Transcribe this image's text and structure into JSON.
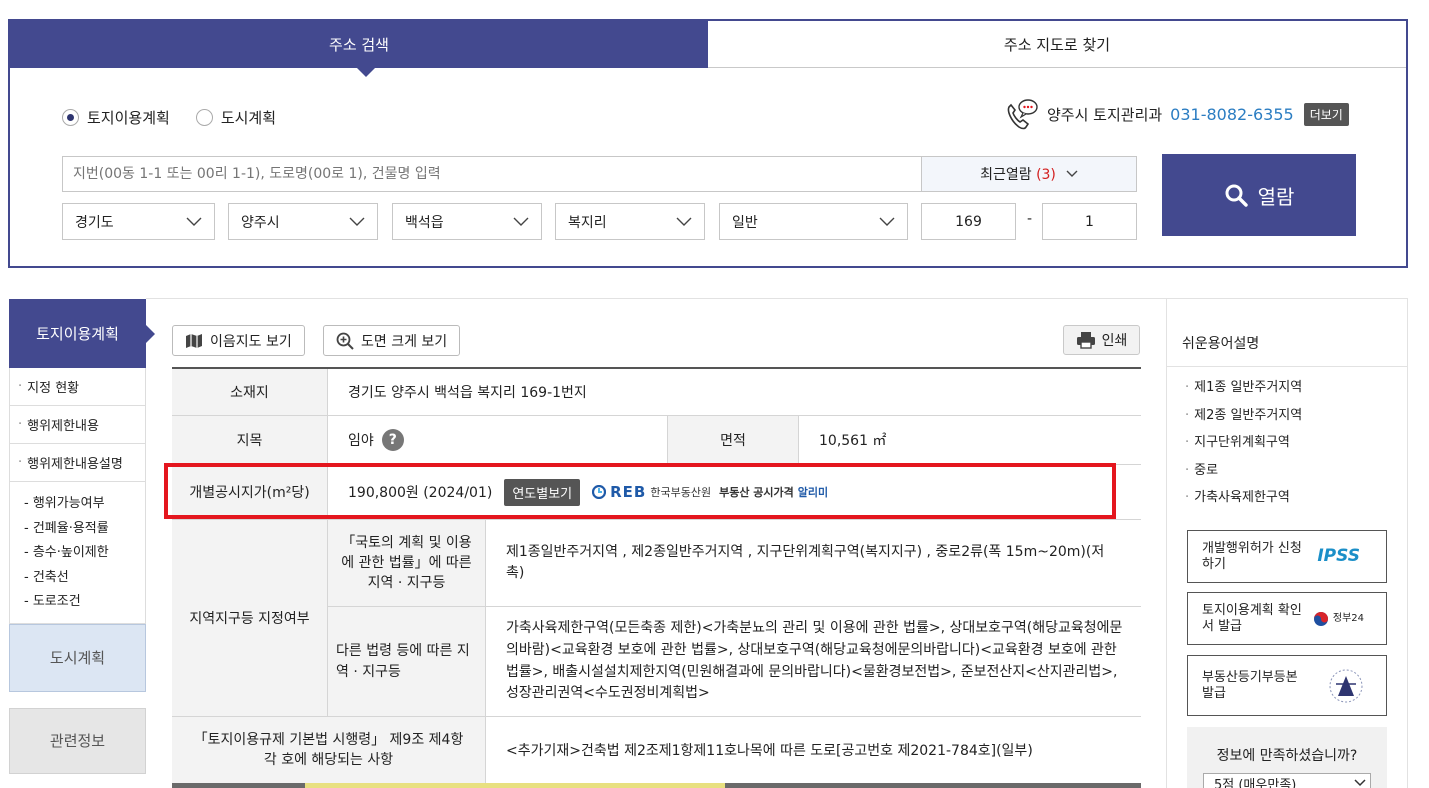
{
  "tabs": {
    "search": "주소 검색",
    "map": "주소 지도로 찾기"
  },
  "radios": [
    {
      "label": "토지이용계획",
      "checked": true
    },
    {
      "label": "도시계획",
      "checked": false
    }
  ],
  "contact": {
    "office": "양주시 토지관리과",
    "phone": "031-8082-6355",
    "more": "더보기"
  },
  "search": {
    "placeholder": "지번(00동 1-1 또는 00리 1-1), 도로명(00로 1), 건물명 입력",
    "recent_label": "최근열람",
    "recent_count": "(3)",
    "button": "열람"
  },
  "selects": {
    "province": "경기도",
    "city": "양주시",
    "town": "백석읍",
    "village": "복지리",
    "type": "일반",
    "main_no": "169",
    "dash": "-",
    "sub_no": "1"
  },
  "left_nav": {
    "head": "토지이용계획",
    "items": [
      "지정 현황",
      "행위제한내용",
      "행위제한내용설명"
    ],
    "sub_items": [
      "- 행위가능여부",
      "- 건폐율·용적률",
      "- 층수·높이제한",
      "- 건축선",
      "- 도로조건"
    ],
    "urban": "도시계획",
    "related": "관련정보"
  },
  "toolbar": {
    "map_view": "이음지도 보기",
    "zoom_view": "도면 크게 보기",
    "print": "인쇄"
  },
  "info": {
    "location_label": "소재지",
    "location": "경기도 양주시 백석읍 복지리 169-1번지",
    "jimok_label": "지목",
    "jimok": "임야",
    "area_label": "면적",
    "area": "10,561 ㎡",
    "price_label": "개별공시지가(m²당)",
    "price": "190,800원 (2024/01)",
    "year_btn": "연도별보기",
    "reb_logo": "REB",
    "reb_name": "한국부동산원",
    "reb_service": "부동산 공시가격",
    "reb_app": "알리미",
    "zone_label": "지역지구등 지정여부",
    "zone_sub1_label": "「국토의 계획 및 이용에 관한 법률」에 따른 지역 · 지구등",
    "zone_sub1": "제1종일반주거지역 , 제2종일반주거지역 , 지구단위계획구역(복지지구) , 중로2류(폭 15m~20m)(저촉)",
    "zone_sub2_label": "다른 법령 등에 따른 지역 · 지구등",
    "zone_sub2": "가축사육제한구역(모든축종 제한)<가축분뇨의 관리 및 이용에 관한 법률>, 상대보호구역(해당교육청에문의바람)<교육환경 보호에 관한 법률>, 상대보호구역(해당교육청에문의바랍니다)<교육환경 보호에 관한 법률>, 배출시설설치제한지역(민원해결과에 문의바랍니다)<물환경보전법>, 준보전산지<산지관리법>, 성장관리권역<수도권정비계획법>",
    "decree_label": "「토지이용규제 기본법 시행령」 제9조 제4항 각 호에 해당되는 사항",
    "decree": "<추가기재>건축법 제2조제1항제11호나목에 따른 도로[공고번호 제2021-784호](일부)"
  },
  "right_side": {
    "title": "쉬운용어설명",
    "glossary": [
      "제1종 일반주거지역",
      "제2종 일반주거지역",
      "지구단위계획구역",
      "중로",
      "가축사육제한구역"
    ],
    "box1": "개발행위허가 신청하기",
    "box1_logo": "IPSS",
    "box2": "토지이용계획 확인서 발급",
    "box2_logo": "정부24",
    "box3": "부동산등기부등본 발급",
    "survey_q": "정보에 만족하셨습니까?",
    "survey_sel": "5점 (매우만족)"
  },
  "colors": {
    "brand": "#43498f",
    "highlight": "#e4161e",
    "phone": "#2b7dc2"
  }
}
